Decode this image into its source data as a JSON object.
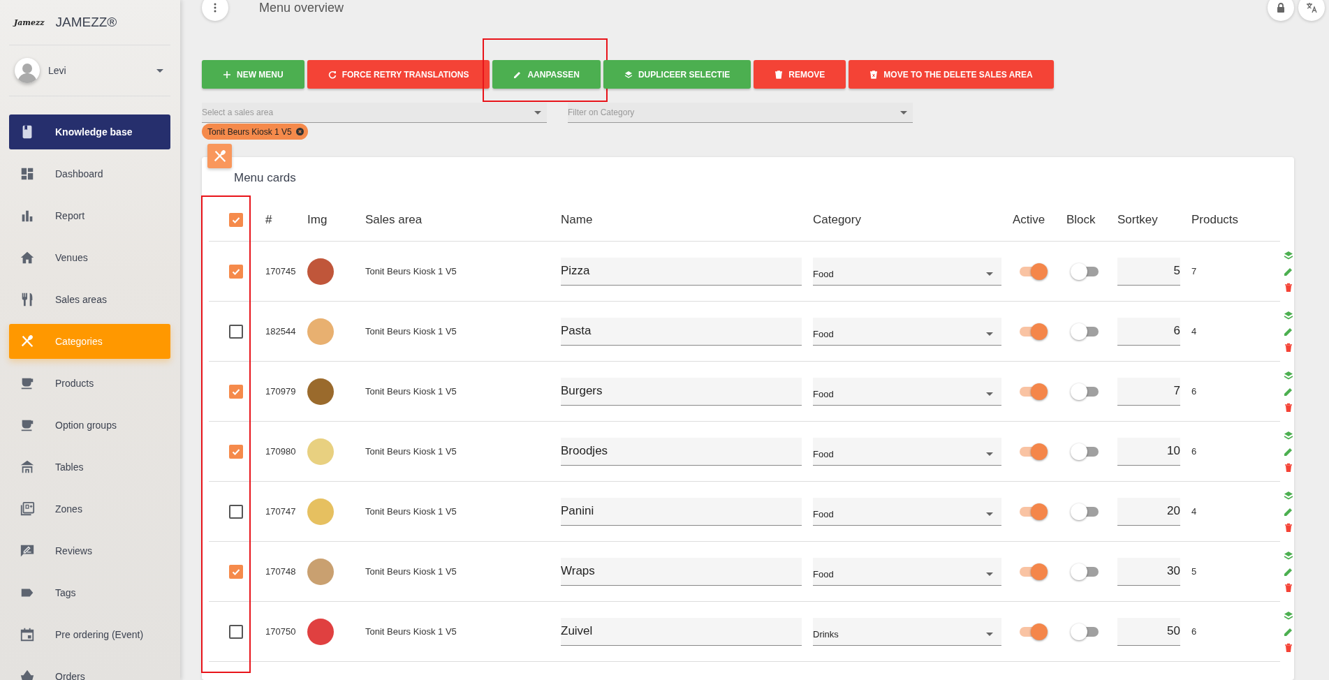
{
  "sidebar": {
    "logo_text": "Jamezz",
    "brand": "JAMEZZ®",
    "user": {
      "name": "Levi"
    },
    "items": [
      {
        "label": "Knowledge base",
        "kind": "promo",
        "selected": false
      },
      {
        "label": "Dashboard",
        "kind": "link",
        "selected": false
      },
      {
        "label": "Report",
        "kind": "link",
        "selected": false
      },
      {
        "label": "Venues",
        "kind": "link",
        "selected": false
      },
      {
        "label": "Sales areas",
        "kind": "link",
        "selected": false
      },
      {
        "label": "Categories",
        "kind": "link",
        "selected": true
      },
      {
        "label": "Products",
        "kind": "link",
        "selected": false
      },
      {
        "label": "Option groups",
        "kind": "link",
        "selected": false
      },
      {
        "label": "Tables",
        "kind": "link",
        "selected": false
      },
      {
        "label": "Zones",
        "kind": "link",
        "selected": false
      },
      {
        "label": "Reviews",
        "kind": "link",
        "selected": false
      },
      {
        "label": "Tags",
        "kind": "link",
        "selected": false
      },
      {
        "label": "Pre ordering (Event)",
        "kind": "link",
        "selected": false
      },
      {
        "label": "Orders",
        "kind": "link",
        "selected": false
      }
    ]
  },
  "page": {
    "title": "Menu overview"
  },
  "toolbar": {
    "buttons": [
      {
        "label": "NEW MENU",
        "color": "#4caf50",
        "highlighted": false
      },
      {
        "label": "FORCE RETRY TRANSLATIONS",
        "color": "#f44336",
        "highlighted": false
      },
      {
        "label": "AANPASSEN",
        "color": "#4caf50",
        "highlighted": true
      },
      {
        "label": "DUPLICEER SELECTIE",
        "color": "#4caf50",
        "highlighted": false
      },
      {
        "label": "REMOVE",
        "color": "#f44336",
        "highlighted": false
      },
      {
        "label": "MOVE TO THE DELETE SALES AREA",
        "color": "#f44336",
        "highlighted": false
      }
    ]
  },
  "filters": {
    "sales_area": {
      "placeholder": "Select a sales area",
      "chips": [
        "Tonit Beurs Kiosk 1 V5"
      ]
    },
    "category": {
      "placeholder": "Filter on Category"
    }
  },
  "table": {
    "title": "Menu cards",
    "checkbox_column_highlighted": true,
    "all_checked": true,
    "columns": [
      "#",
      "Img",
      "Sales area",
      "Name",
      "Category",
      "Active",
      "Block",
      "Sortkey",
      "Products"
    ],
    "rows": [
      {
        "checked": true,
        "id": "170745",
        "sales_area": "Tonit Beurs Kiosk 1 V5",
        "name": "Pizza",
        "category": "Food",
        "active": true,
        "block": false,
        "sortkey": "5",
        "products": "7"
      },
      {
        "checked": false,
        "id": "182544",
        "sales_area": "Tonit Beurs Kiosk 1 V5",
        "name": "Pasta",
        "category": "Food",
        "active": true,
        "block": false,
        "sortkey": "6",
        "products": "4"
      },
      {
        "checked": true,
        "id": "170979",
        "sales_area": "Tonit Beurs Kiosk 1 V5",
        "name": "Burgers",
        "category": "Food",
        "active": true,
        "block": false,
        "sortkey": "7",
        "products": "6"
      },
      {
        "checked": true,
        "id": "170980",
        "sales_area": "Tonit Beurs Kiosk 1 V5",
        "name": "Broodjes",
        "category": "Food",
        "active": true,
        "block": false,
        "sortkey": "10",
        "products": "6"
      },
      {
        "checked": false,
        "id": "170747",
        "sales_area": "Tonit Beurs Kiosk 1 V5",
        "name": "Panini",
        "category": "Food",
        "active": true,
        "block": false,
        "sortkey": "20",
        "products": "4"
      },
      {
        "checked": true,
        "id": "170748",
        "sales_area": "Tonit Beurs Kiosk 1 V5",
        "name": "Wraps",
        "category": "Food",
        "active": true,
        "block": false,
        "sortkey": "30",
        "products": "5"
      },
      {
        "checked": false,
        "id": "170750",
        "sales_area": "Tonit Beurs Kiosk 1 V5",
        "name": "Zuivel",
        "category": "Drinks",
        "active": true,
        "block": false,
        "sortkey": "50",
        "products": "6"
      }
    ]
  }
}
